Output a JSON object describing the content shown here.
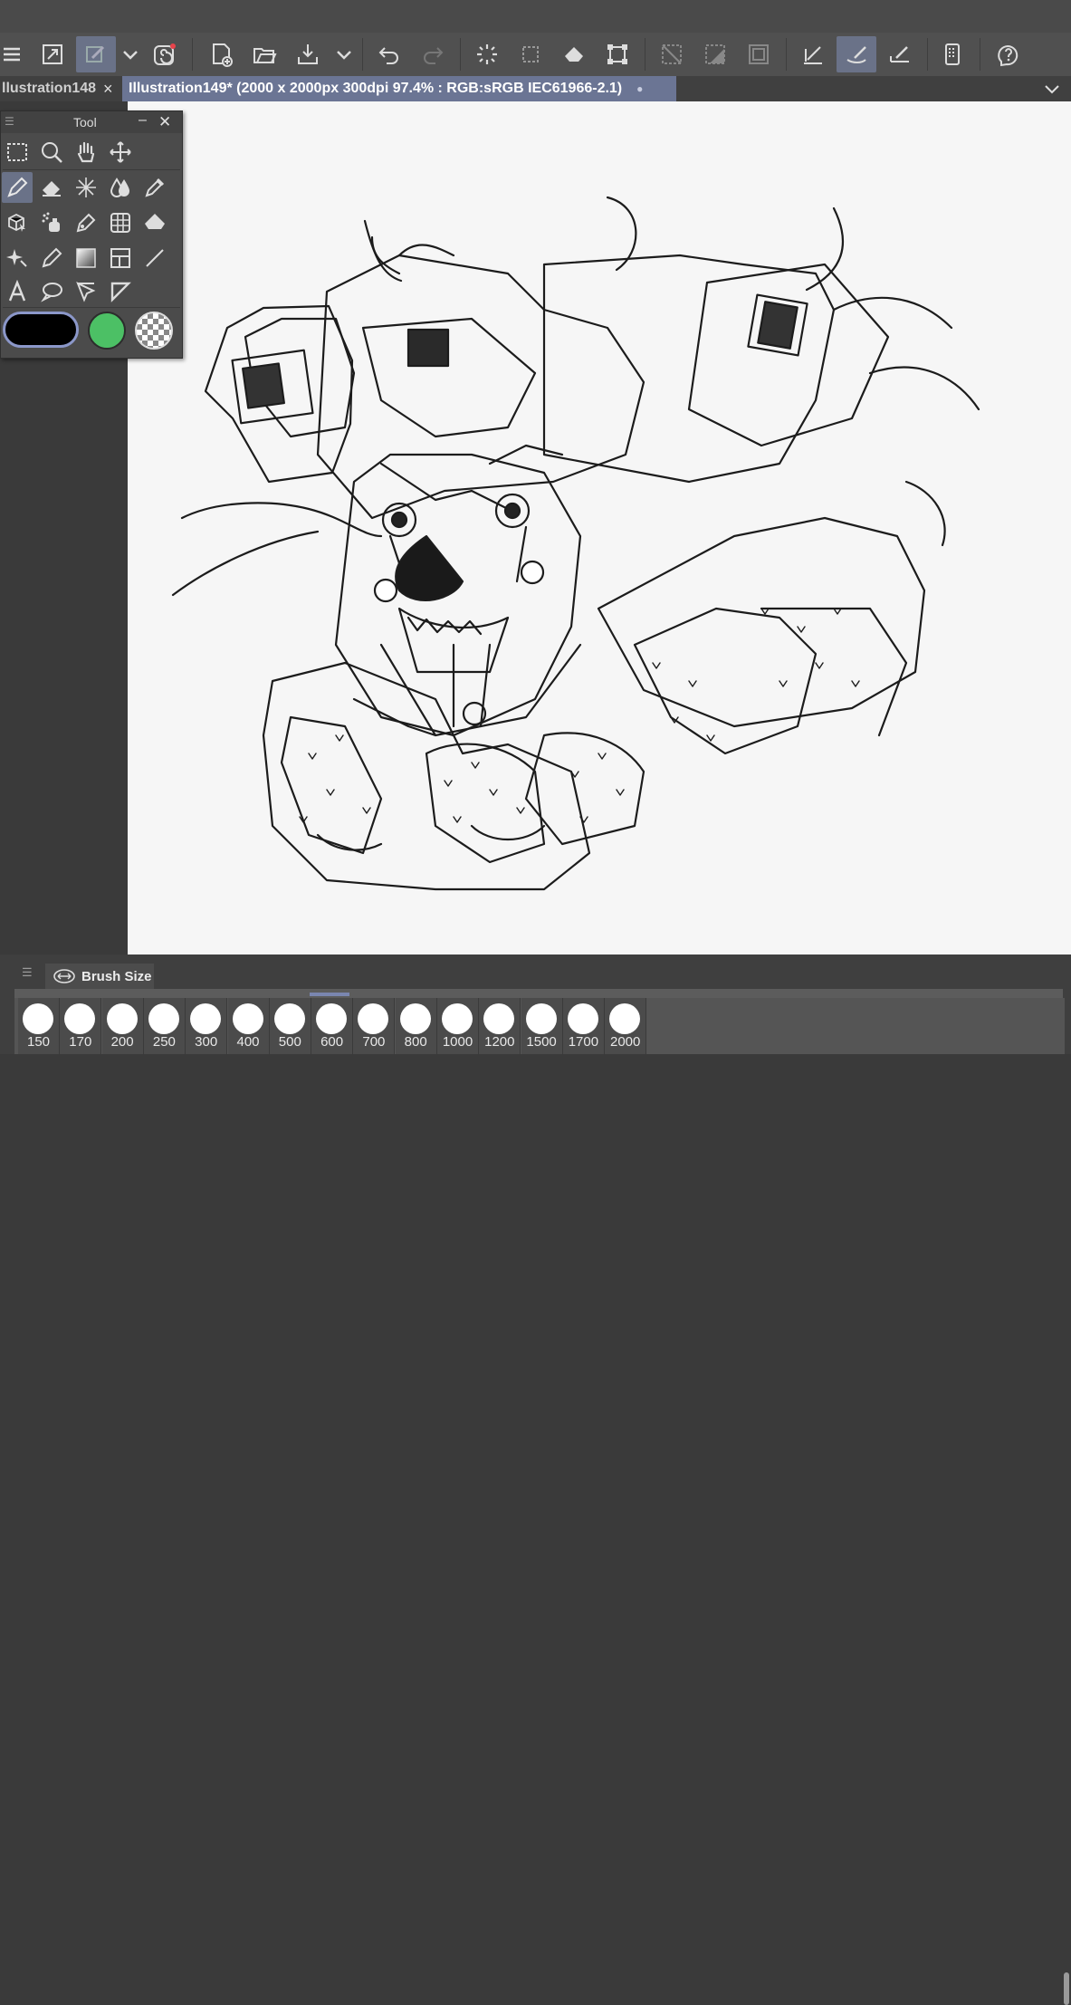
{
  "toolbar": {
    "buttons": [
      "menu-icon",
      "fit-view-icon",
      "undo-history-icon",
      "dropdown-chevron-icon",
      "spiral-icon",
      "new-canvas-icon",
      "open-folder-icon",
      "export-icon",
      "export-dropdown-icon",
      "undo-icon",
      "redo-icon",
      "selection-spin-icon",
      "select-layer-icon",
      "fill-icon",
      "transform-icon",
      "deselect-icon",
      "invert-selection-icon",
      "selection-border-icon",
      "pen-correct-icon",
      "brush-active-icon",
      "ruler-pen-icon",
      "tablet-icon",
      "help-icon"
    ]
  },
  "tabs": {
    "inactive_label": "llustration148",
    "active_label": "Illustration149* (2000 x 2000px 300dpi 97.4% : RGB:sRGB IEC61966-2.1)",
    "close_glyph": "×",
    "modified_dot": "●"
  },
  "tool_panel": {
    "title": "Tool",
    "minimize_glyph": "–",
    "close_glyph": "✕",
    "grip_glyph": "☰",
    "main_color": "#000000",
    "sub_color": "#4cc065"
  },
  "brush_size": {
    "tab_label": "Brush Size",
    "grip_glyph": "☰",
    "sizes": [
      "150",
      "170",
      "200",
      "250",
      "300",
      "400",
      "500",
      "600",
      "700",
      "800",
      "1000",
      "1200",
      "1500",
      "1700",
      "2000"
    ]
  }
}
